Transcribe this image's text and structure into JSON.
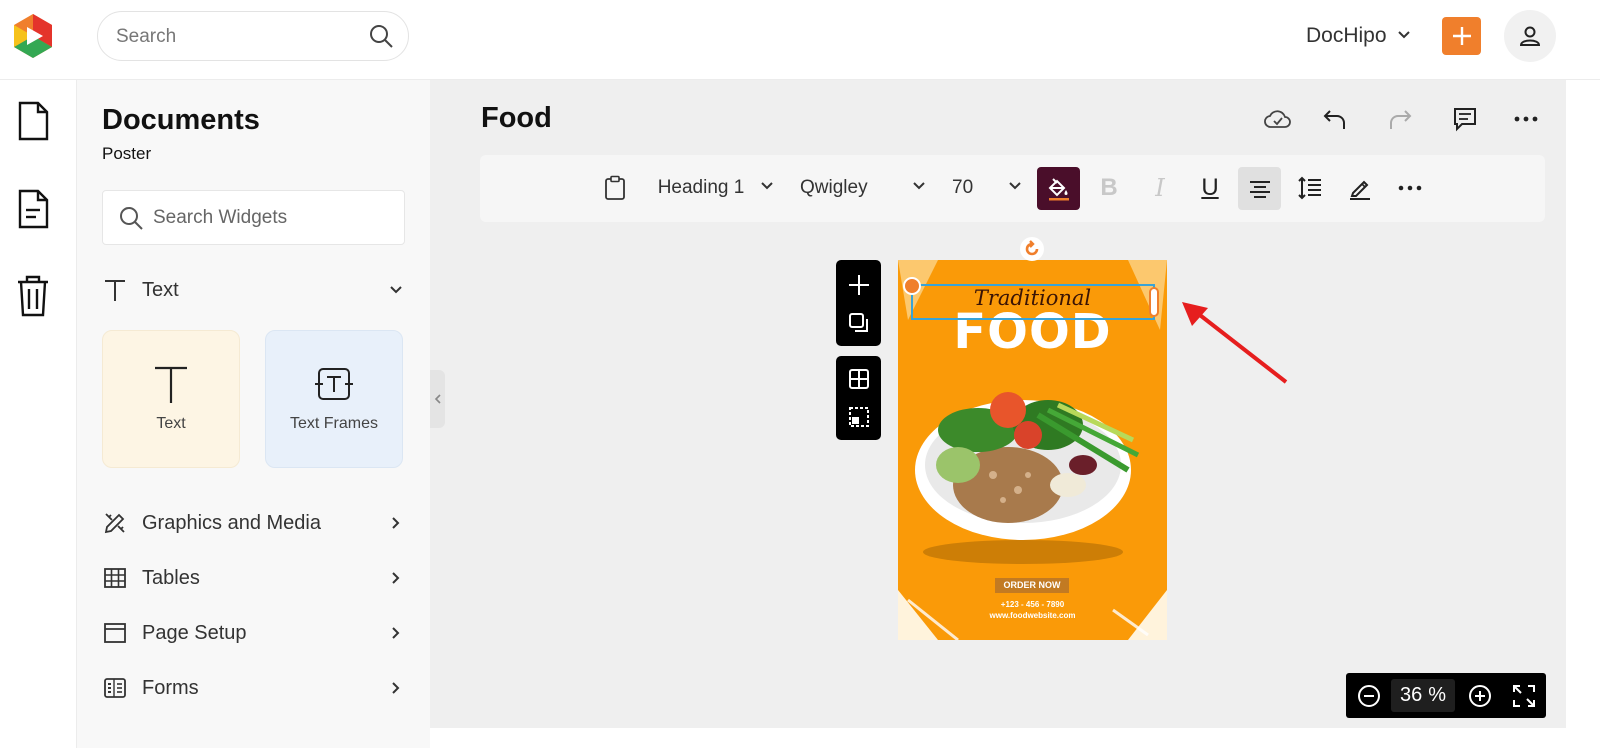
{
  "header": {
    "search_placeholder": "Search",
    "account_name": "DocHipo",
    "colors": {
      "brand_orange": "#f07f2c"
    }
  },
  "rail": {
    "items": [
      "document-icon",
      "file-text-icon",
      "trash-icon"
    ]
  },
  "panel": {
    "title": "Documents",
    "subtitle": "Poster",
    "search_placeholder": "Search Widgets",
    "text_section": {
      "label": "Text",
      "cards": [
        {
          "label": "Text"
        },
        {
          "label": "Text Frames"
        }
      ]
    },
    "sections": [
      {
        "label": "Graphics and Media"
      },
      {
        "label": "Tables"
      },
      {
        "label": "Page Setup"
      },
      {
        "label": "Forms"
      }
    ]
  },
  "editor": {
    "doc_title": "Food",
    "toolbar": {
      "style": "Heading 1",
      "font": "Qwigley",
      "size": "70",
      "bold": "B",
      "italic": "I",
      "underline": "U"
    },
    "poster": {
      "script_text": "Traditional",
      "headline": "FOOD",
      "order_button": "ORDER NOW",
      "phone": "+123 - 456 - 7890",
      "website": "www.foodwebsite.com",
      "colors": {
        "background": "#fa9a08",
        "selection": "#39a3d6"
      }
    },
    "zoom": {
      "value": "36",
      "unit": "%"
    }
  }
}
